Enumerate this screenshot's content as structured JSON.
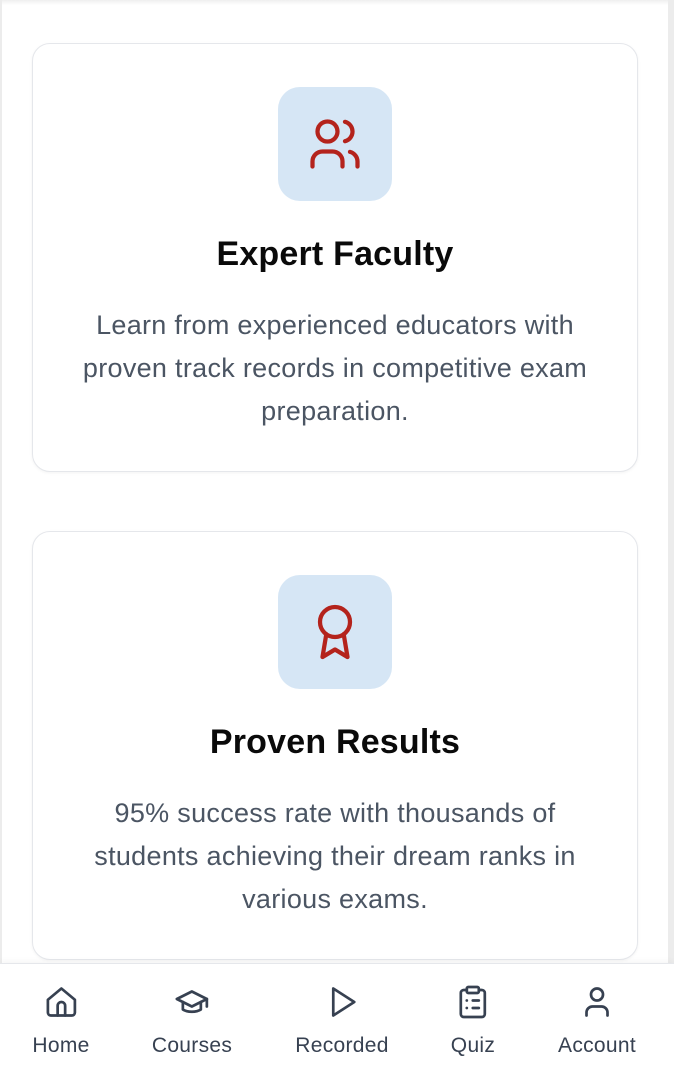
{
  "features": [
    {
      "icon": "users-icon",
      "title": "Expert Faculty",
      "description": "Learn from experienced educators with proven track records in competitive exam preparation."
    },
    {
      "icon": "award-ribbon-icon",
      "title": "Proven Results",
      "description": "95% success rate with thousands of students achieving their dream ranks in various exams."
    }
  ],
  "colors": {
    "icon_tile_bg": "#d6e6f5",
    "icon_stroke": "#b4231c",
    "title": "#0a0a0a",
    "body_text": "#4b5563",
    "nav_text": "#374151"
  },
  "bottom_nav": {
    "items": [
      {
        "icon": "home-icon",
        "label": "Home"
      },
      {
        "icon": "graduation-cap-icon",
        "label": "Courses"
      },
      {
        "icon": "play-icon",
        "label": "Recorded"
      },
      {
        "icon": "clipboard-list-icon",
        "label": "Quiz"
      },
      {
        "icon": "user-icon",
        "label": "Account"
      }
    ]
  }
}
